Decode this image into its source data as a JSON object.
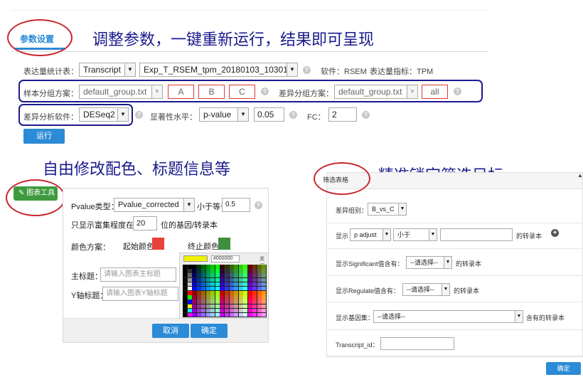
{
  "tab": {
    "label": "参数设置"
  },
  "headline_top": "调整参数，一键重新运行，结果即可呈现",
  "headline_left": "自由修改配色、标题信息等",
  "headline_right": "精准锁定筛选目标",
  "params": {
    "expr_table_label": "表达量统计表：",
    "expr_table_value": "Transcript",
    "expr_file_value": "Exp_T_RSEM_tpm_20180103_103011",
    "software_label": "软件：RSEM",
    "expr_metric_label": "表达量指标：TPM",
    "sample_group_label": "样本分组方案：",
    "sample_group_value": "default_group.txt",
    "groups": [
      "A",
      "B",
      "C"
    ],
    "diff_group_label": "差异分组方案：",
    "diff_group_value": "default_group.txt",
    "diff_group_tag": "all",
    "diff_software_label": "差异分析软件：",
    "diff_software_value": "DESeq2",
    "sig_level_label": "显著性水平：",
    "sig_level_value": "p-value",
    "sig_threshold": "0.05",
    "fc_label": "FC：",
    "fc_value": "2",
    "run_button": "运行"
  },
  "chart_tool": {
    "button_label": "图表工具",
    "pvalue_type_label": "Pvalue类型：",
    "pvalue_type_value": "Pvalue_corrected",
    "le_label": "小于等于",
    "le_value": "0.5",
    "top_label": "只显示富集程度在前",
    "top_value": "20",
    "top_suffix": "位的基因/转录本",
    "color_scheme_label": "颜色方案：",
    "start_color_label": "起始颜色",
    "start_color": "#e8403a",
    "end_color_label": "终止颜色",
    "end_color": "#3f8f3f",
    "hex_value": "#000000",
    "close_label": "关闭",
    "main_title_label": "主标题：",
    "main_title_placeholder": "请输入图表主标题",
    "y_title_label": "Y轴标题：",
    "y_title_placeholder": "请输入图表Y轴标题",
    "cancel_button": "取消",
    "ok_button": "确定"
  },
  "filter_table": {
    "title": "筛选表格",
    "diff_group_label": "差异组别：",
    "diff_group_value": "B_vs_C",
    "show_label": "显示",
    "metric_value": "p adjust",
    "op_value": "小于",
    "transcript_suffix": "的转录本",
    "significant_label": "显示Significant值含有：",
    "significant_value": "--请选择--",
    "significant_suffix": "的转录本",
    "regulate_label": "显示Regulate值含有：",
    "regulate_value": "--请选择--",
    "regulate_suffix": "的转录本",
    "geneset_label": "显示基因集：",
    "geneset_value": "--请选择--",
    "geneset_suffix": "含有的转录本",
    "transcript_id_label": "Transcript_id：",
    "ok_button": "确定"
  },
  "colors": {
    "accent_blue": "#2b8bd6",
    "annotation_navy": "#1b1a8c",
    "annotation_red": "#c8272d",
    "green_button": "#3f9a3f"
  }
}
